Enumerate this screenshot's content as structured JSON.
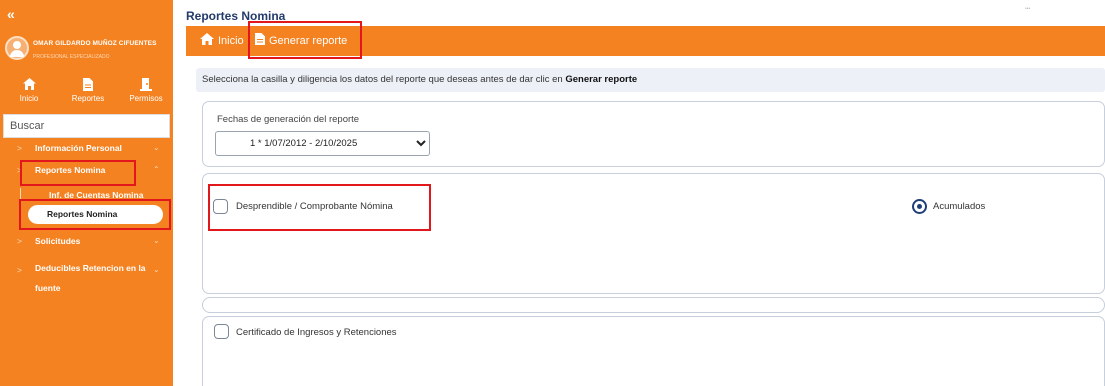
{
  "sidebar": {
    "collapse_icon": "«",
    "user": {
      "name": "OMAR GILDARDO MUÑOZ CIFUENTES",
      "role": "PROFESIONAL ESPECIALIZADO"
    },
    "nav": [
      {
        "icon": "home-icon",
        "label": "Inicio"
      },
      {
        "icon": "document-icon",
        "label": "Reportes"
      },
      {
        "icon": "permissions-icon",
        "label": "Permisos"
      }
    ],
    "search": {
      "placeholder": "Buscar"
    },
    "menu": [
      {
        "label": "Información Personal"
      },
      {
        "label": "Reportes Nomina"
      },
      {
        "label": "Solicitudes"
      },
      {
        "label": "Deducibles Retencion en la fuente"
      }
    ],
    "submenu": [
      {
        "label": "Inf. de Cuentas Nomina"
      },
      {
        "label": "Reportes Nomina"
      }
    ]
  },
  "header": {
    "title": "Reportes Nomina",
    "breadcrumb": [
      {
        "icon": "home-icon",
        "label": "Inicio"
      },
      {
        "icon": "document-icon",
        "label": "Generar reporte"
      }
    ]
  },
  "main": {
    "instructions": "Selecciona la casilla y diligencia los datos del reporte que deseas antes de dar clic en ",
    "instructions_bold": "Generar reporte",
    "date_label": "Fechas de generación del reporte",
    "date_selected": "1 * 1/07/2012 - 2/10/2025",
    "report1": {
      "label": "Desprendible / Comprobante Nómina",
      "checked": false
    },
    "accum": {
      "label": "Acumulados",
      "selected": true
    },
    "report2": {
      "label": "Certificado de Ingresos y Retenciones",
      "checked": false
    }
  },
  "colors": {
    "brand_orange": "#f58220",
    "title_blue": "#233a6b",
    "highlight_red": "#e2171b",
    "radio_blue": "#1f3f7a"
  }
}
